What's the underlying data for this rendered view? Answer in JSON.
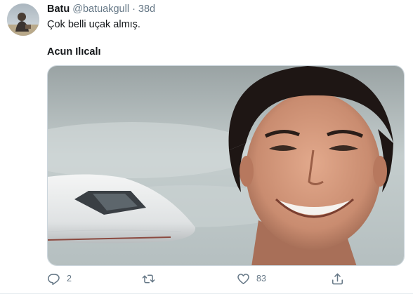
{
  "tweet": {
    "display_name": "Batu",
    "handle": "@batuakgull",
    "separator": "·",
    "time": "38d",
    "text": "Çok belli uçak almış.",
    "caption": "Acun Ilıcalı",
    "avatar_icon": "user-avatar",
    "media_description_icon": "photo-media"
  },
  "actions": {
    "reply_count": "2",
    "retweet_count": "",
    "like_count": "83",
    "reply_icon": "reply-icon",
    "retweet_icon": "retweet-icon",
    "like_icon": "heart-icon",
    "share_icon": "share-icon"
  },
  "colors": {
    "secondary_text": "#657786",
    "primary_text": "#14171a",
    "border": "#ccd6dd"
  }
}
